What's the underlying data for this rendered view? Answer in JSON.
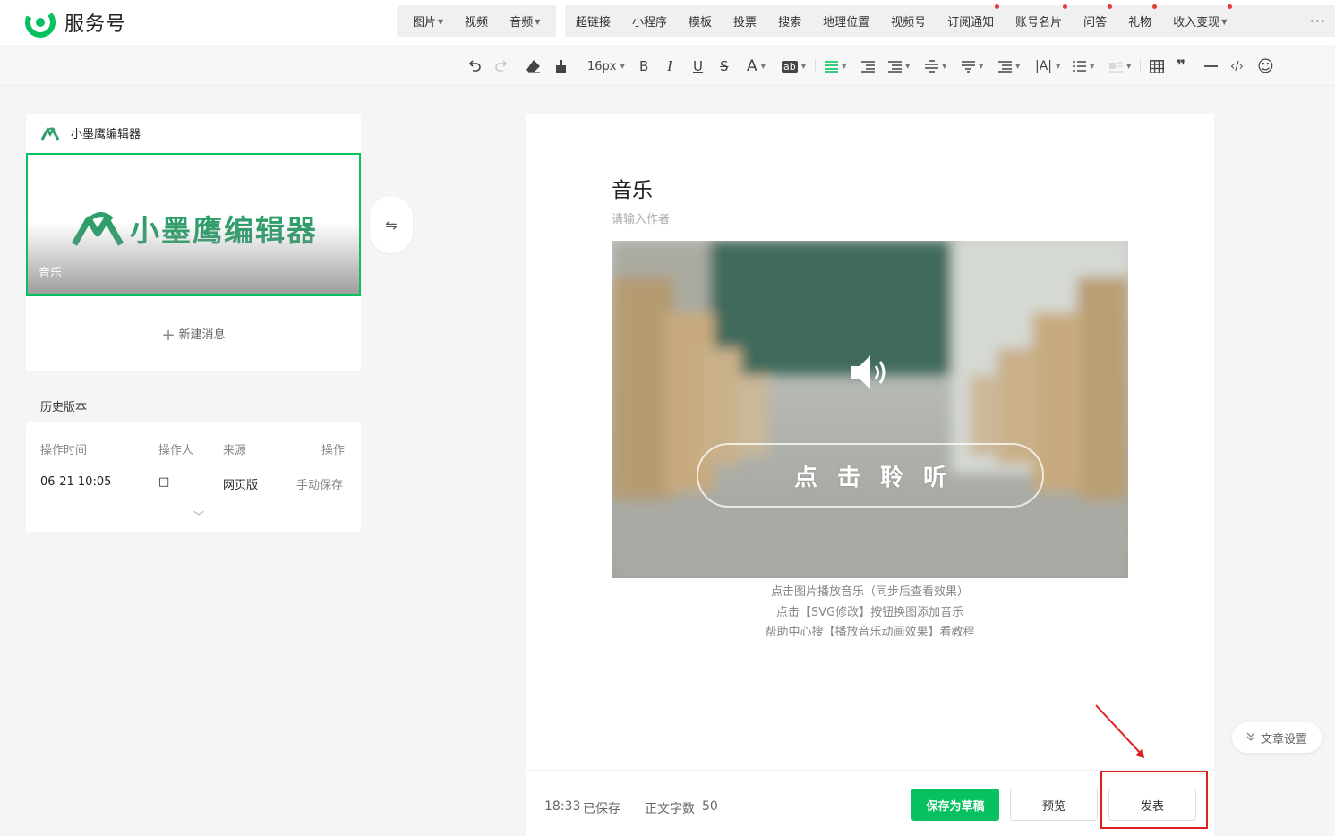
{
  "brand": {
    "name": "服务号"
  },
  "media_menu": [
    {
      "label": "图片",
      "has_caret": true
    },
    {
      "label": "视频",
      "has_caret": false
    },
    {
      "label": "音频",
      "has_caret": true
    }
  ],
  "insert_menu": [
    {
      "label": "超链接",
      "dot": false,
      "caret": false
    },
    {
      "label": "小程序",
      "dot": false,
      "caret": false
    },
    {
      "label": "模板",
      "dot": false,
      "caret": false
    },
    {
      "label": "投票",
      "dot": false,
      "caret": false
    },
    {
      "label": "搜索",
      "dot": false,
      "caret": false
    },
    {
      "label": "地理位置",
      "dot": false,
      "caret": false
    },
    {
      "label": "视频号",
      "dot": false,
      "caret": false
    },
    {
      "label": "订阅通知",
      "dot": true,
      "caret": false
    },
    {
      "label": "账号名片",
      "dot": true,
      "caret": false
    },
    {
      "label": "问答",
      "dot": true,
      "caret": false
    },
    {
      "label": "礼物",
      "dot": true,
      "caret": false
    },
    {
      "label": "收入变现",
      "dot": true,
      "caret": true
    }
  ],
  "more_label": "···",
  "format_toolbar": {
    "font_size": "16px",
    "bold": "B",
    "italic": "I",
    "underline": "U",
    "strike": "S",
    "font_color": "A",
    "bg_color": "ab",
    "letter_spacing": "|A|",
    "quote": "❞",
    "code": "‹/›",
    "emoji": "☺"
  },
  "article_list": {
    "header": "小墨鹰编辑器",
    "cover_logo_text": "小墨鹰编辑器",
    "cover_title": "音乐",
    "new_message": "新建消息",
    "plus": "+"
  },
  "swap_icon": "⇋",
  "history": {
    "title": "历史版本",
    "columns": [
      "操作时间",
      "操作人",
      "来源",
      "操作"
    ],
    "rows": [
      {
        "time": "06-21 10:05",
        "operator": "□",
        "source": "网页版",
        "action": "手动保存"
      }
    ],
    "expand_icon": "﹀"
  },
  "article": {
    "title": "音乐",
    "author_placeholder": "请输入作者",
    "play_text": "点击聆听",
    "captions": [
      "点击图片播放音乐（同步后查看效果）",
      "点击【SVG修改】按钮换图添加音乐",
      "帮助中心搜【播放音乐动画效果】看教程"
    ]
  },
  "footer": {
    "saved_time": "18:33",
    "saved_label": "已保存",
    "word_count_label": "正文字数",
    "word_count": "50",
    "save_draft": "保存为草稿",
    "preview": "预览",
    "publish": "发表"
  },
  "article_settings": {
    "label": "文章设置",
    "icon": "≫"
  },
  "colors": {
    "accent": "#07c160",
    "annotation": "#e02020",
    "brand_logo": "#2e9e6b"
  }
}
